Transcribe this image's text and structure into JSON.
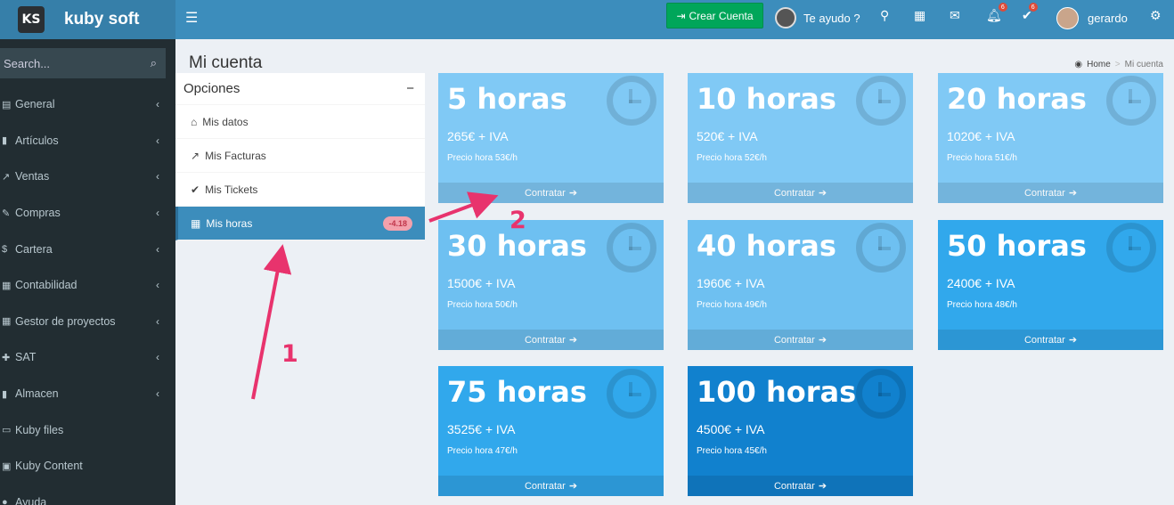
{
  "app": {
    "logo_mark": "KS",
    "name": "kuby soft"
  },
  "topbar": {
    "menu_icon": "☰",
    "create_label": "Crear Cuenta",
    "help_label": "Te ayudo ?",
    "notif_count": "6",
    "tasks_count": "6",
    "user_name": "gerardo"
  },
  "sidebar": {
    "search_placeholder": "Search...",
    "items": [
      {
        "label": "General",
        "icon": "▤"
      },
      {
        "label": "Artículos",
        "icon": "▮"
      },
      {
        "label": "Ventas",
        "icon": "↗"
      },
      {
        "label": "Compras",
        "icon": "✎"
      },
      {
        "label": "Cartera",
        "icon": "$"
      },
      {
        "label": "Contabilidad",
        "icon": "▦"
      },
      {
        "label": "Gestor de proyectos",
        "icon": "▦"
      },
      {
        "label": "SAT",
        "icon": "✚"
      },
      {
        "label": "Almacen",
        "icon": "▮"
      },
      {
        "label": "Kuby files",
        "icon": "▭"
      },
      {
        "label": "Kuby Content",
        "icon": "▣"
      },
      {
        "label": "Ayuda",
        "icon": "●"
      }
    ]
  },
  "page": {
    "title": "Mi cuenta",
    "breadcrumb": {
      "home": "Home",
      "sep": ">",
      "current": "Mi cuenta"
    }
  },
  "options": {
    "title": "Opciones",
    "items": [
      {
        "label": "Mis datos",
        "icon": "⌂"
      },
      {
        "label": "Mis Facturas",
        "icon": "↗"
      },
      {
        "label": "Mis Tickets",
        "icon": "✔"
      },
      {
        "label": "Mis horas",
        "icon": "▦",
        "badge": "-4.18"
      }
    ]
  },
  "packs": [
    {
      "title": "5 horas",
      "price": "265€ + IVA",
      "rate": "Precio hora 53€/h",
      "color": "#80c9f5"
    },
    {
      "title": "10 horas",
      "price": "520€ + IVA",
      "rate": "Precio hora 52€/h",
      "color": "#80c9f5"
    },
    {
      "title": "20 horas",
      "price": "1020€ + IVA",
      "rate": "Precio hora 51€/h",
      "color": "#80c9f5"
    },
    {
      "title": "30 horas",
      "price": "1500€ + IVA",
      "rate": "Precio hora 50€/h",
      "color": "#6ec0f1"
    },
    {
      "title": "40 horas",
      "price": "1960€ + IVA",
      "rate": "Precio hora 49€/h",
      "color": "#6ec0f1"
    },
    {
      "title": "50 horas",
      "price": "2400€ + IVA",
      "rate": "Precio hora 48€/h",
      "color": "#31a8ec"
    },
    {
      "title": "75 horas",
      "price": "3525€ + IVA",
      "rate": "Precio hora 47€/h",
      "color": "#31a8ec"
    },
    {
      "title": "100 horas",
      "price": "4500€ + IVA",
      "rate": "Precio hora 45€/h",
      "color": "#1181ce"
    }
  ],
  "contratar_label": "Contratar",
  "annotations": {
    "one": "1",
    "two": "2"
  }
}
